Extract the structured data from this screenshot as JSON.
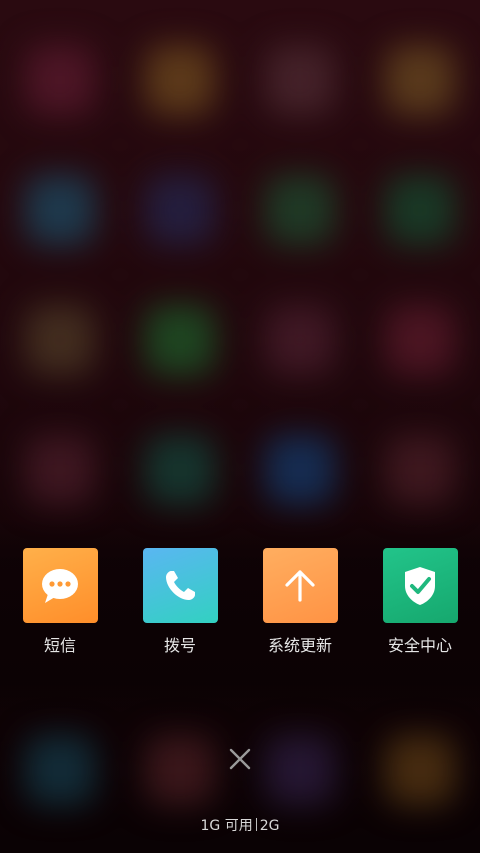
{
  "recent_apps": [
    {
      "label": "短信",
      "icon": "message-bubble-icon",
      "color": "#ff9a35"
    },
    {
      "label": "拨号",
      "icon": "phone-icon",
      "color": "#45c3d9"
    },
    {
      "label": "系统更新",
      "icon": "arrow-up-icon",
      "color": "#ffa152"
    },
    {
      "label": "安全中心",
      "icon": "shield-check-icon",
      "color": "#1fb87e"
    }
  ],
  "close_icon": "close-icon",
  "memory": {
    "available": "1G 可用",
    "total": "2G"
  }
}
